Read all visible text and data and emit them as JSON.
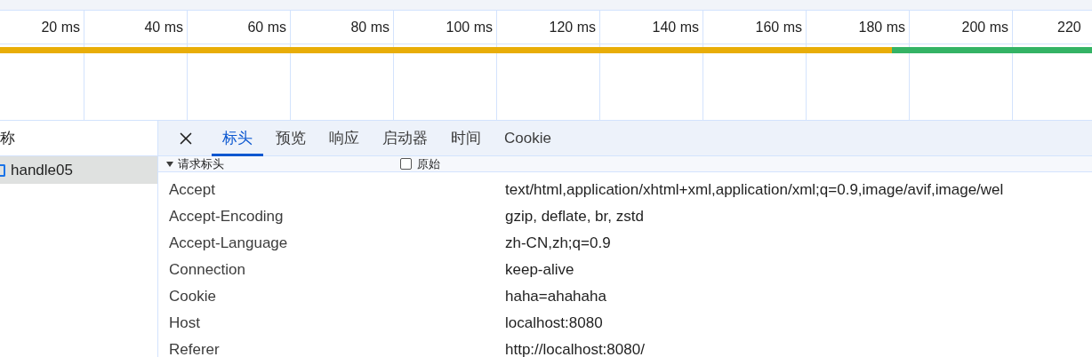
{
  "timeline": {
    "ticks": [
      "20 ms",
      "40 ms",
      "60 ms",
      "80 ms",
      "100 ms",
      "120 ms",
      "140 ms",
      "160 ms",
      "180 ms",
      "200 ms",
      "220"
    ]
  },
  "requests": {
    "header": "称",
    "rows": [
      {
        "name": "handle05",
        "selected": true
      }
    ]
  },
  "detail": {
    "tabs": [
      {
        "label": "标头",
        "selected": true
      },
      {
        "label": "预览",
        "selected": false
      },
      {
        "label": "响应",
        "selected": false
      },
      {
        "label": "启动器",
        "selected": false
      },
      {
        "label": "时间",
        "selected": false
      },
      {
        "label": "Cookie",
        "selected": false
      }
    ],
    "section": {
      "title": "请求标头",
      "expanded": true,
      "raw_label": "原始",
      "raw_checked": false
    },
    "headers": [
      {
        "name": "Accept",
        "value": "text/html,application/xhtml+xml,application/xml;q=0.9,image/avif,image/wel"
      },
      {
        "name": "Accept-Encoding",
        "value": "gzip, deflate, br, zstd"
      },
      {
        "name": "Accept-Language",
        "value": "zh-CN,zh;q=0.9"
      },
      {
        "name": "Connection",
        "value": "keep-alive"
      },
      {
        "name": "Cookie",
        "value": "haha=ahahaha"
      },
      {
        "name": "Host",
        "value": "localhost:8080"
      },
      {
        "name": "Referer",
        "value": "http://localhost:8080/"
      }
    ]
  }
}
